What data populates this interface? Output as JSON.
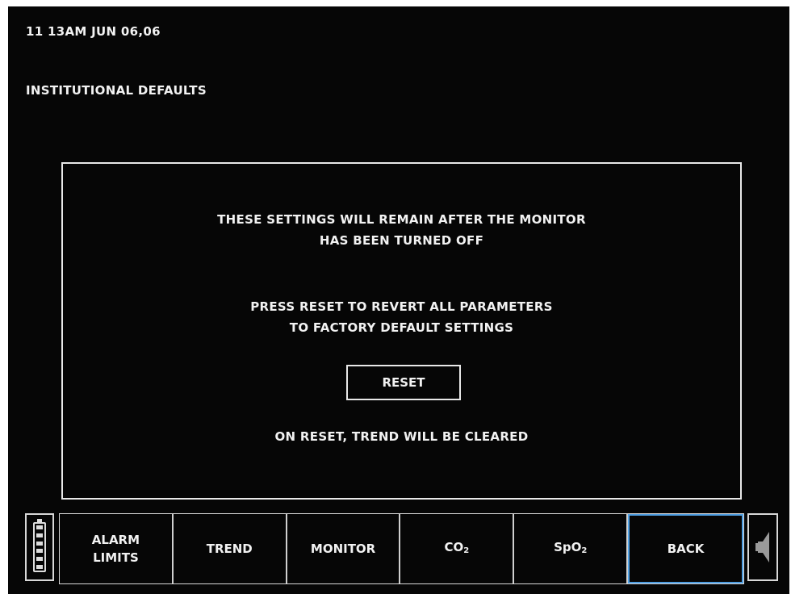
{
  "header": {
    "datetime": "11 13AM  JUN 06,06",
    "title": "INSTITUTIONAL DEFAULTS"
  },
  "panel": {
    "line1": "THESE SETTINGS WILL REMAIN AFTER THE MONITOR",
    "line2": "HAS BEEN TURNED OFF",
    "line3": "PRESS RESET TO REVERT ALL PARAMETERS",
    "line4": "TO FACTORY DEFAULT SETTINGS",
    "reset_label": "RESET",
    "note": "ON RESET, TREND WILL BE CLEARED"
  },
  "battery": {
    "icon": "battery-icon",
    "bars": 6,
    "level": 1.0
  },
  "tabs": {
    "alarm_line1": "ALARM",
    "alarm_line2": "LIMITS",
    "trend": "TREND",
    "monitor": "MONITOR",
    "co2_main": "CO",
    "co2_sub": "2",
    "spo2_main": "SpO",
    "spo2_sub": "2",
    "back": "BACK",
    "active": "BACK"
  },
  "speaker": {
    "icon": "speaker-icon"
  },
  "colors": {
    "background": "#060606",
    "text": "#f2f2f2",
    "border": "#e8e8e8",
    "active_tab": "#4f9fe3"
  }
}
